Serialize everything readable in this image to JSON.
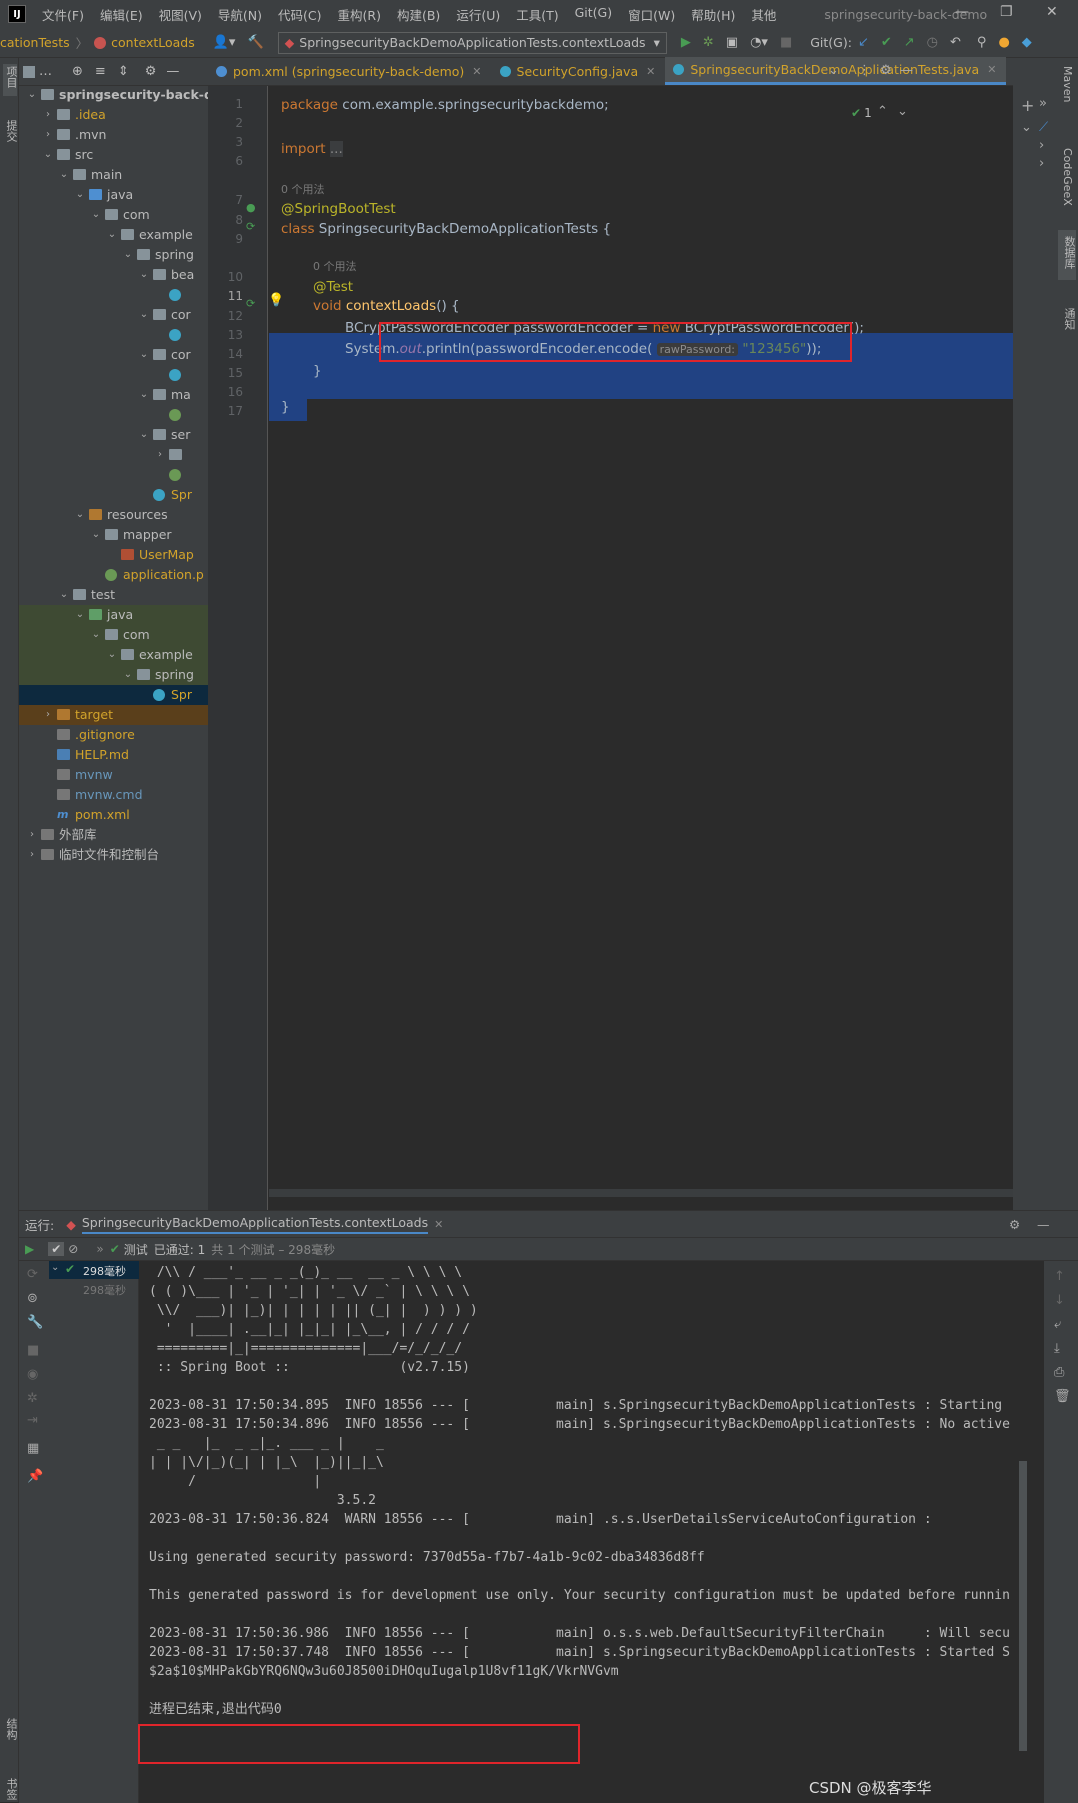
{
  "app": {
    "window_title": "springsecurity-back-demo",
    "menu": [
      "文件(F)",
      "编辑(E)",
      "视图(V)",
      "导航(N)",
      "代码(C)",
      "重构(R)",
      "构建(B)",
      "运行(U)",
      "工具(T)",
      "Git(G)",
      "窗口(W)",
      "帮助(H)",
      "其他"
    ],
    "window_controls": [
      "minimize-icon",
      "restore-icon",
      "close-icon"
    ]
  },
  "toolbar": {
    "breadcrumb": [
      "cationTests",
      "contextLoads"
    ],
    "run_config": "SpringsecurityBackDemoApplicationTests.contextLoads",
    "git_label": "Git(G):"
  },
  "left_strip": {
    "project_label": "项目",
    "commit_label": "提交",
    "bookmarks_label": "书签",
    "structure_label": "结构"
  },
  "project": {
    "header_label": "…",
    "tree": [
      {
        "label": "springsecurity-back-demo",
        "indent": 0,
        "expanded": true,
        "icon": "folder",
        "bold": true
      },
      {
        "label": ".idea",
        "indent": 1,
        "expanded": false,
        "icon": "folder",
        "color": "#d2a32b"
      },
      {
        "label": ".mvn",
        "indent": 1,
        "expanded": false,
        "icon": "folder"
      },
      {
        "label": "src",
        "indent": 1,
        "expanded": true,
        "icon": "folder"
      },
      {
        "label": "main",
        "indent": 2,
        "expanded": true,
        "icon": "folder"
      },
      {
        "label": "java",
        "indent": 3,
        "expanded": true,
        "icon": "folder-src"
      },
      {
        "label": "com",
        "indent": 4,
        "expanded": true,
        "icon": "folder"
      },
      {
        "label": "example",
        "indent": 5,
        "expanded": true,
        "icon": "folder"
      },
      {
        "label": "spring",
        "indent": 6,
        "expanded": true,
        "icon": "folder"
      },
      {
        "label": "bea",
        "indent": 7,
        "expanded": true,
        "icon": "folder"
      },
      {
        "label": "",
        "indent": 8,
        "icon": "class"
      },
      {
        "label": "cor",
        "indent": 7,
        "expanded": true,
        "icon": "folder"
      },
      {
        "label": "",
        "indent": 8,
        "icon": "class"
      },
      {
        "label": "cor",
        "indent": 7,
        "expanded": true,
        "icon": "folder"
      },
      {
        "label": "",
        "indent": 8,
        "icon": "class"
      },
      {
        "label": "ma",
        "indent": 7,
        "expanded": true,
        "icon": "folder"
      },
      {
        "label": "",
        "indent": 8,
        "icon": "interface"
      },
      {
        "label": "ser",
        "indent": 7,
        "expanded": true,
        "icon": "folder"
      },
      {
        "label": "",
        "indent": 8,
        "expanded": false,
        "icon": "folder"
      },
      {
        "label": "",
        "indent": 8,
        "icon": "interface"
      },
      {
        "label": "Spr",
        "indent": 7,
        "icon": "class",
        "color": "#d2a32b"
      },
      {
        "label": "resources",
        "indent": 3,
        "expanded": true,
        "icon": "folder-res"
      },
      {
        "label": "mapper",
        "indent": 4,
        "expanded": true,
        "icon": "folder"
      },
      {
        "label": "UserMap",
        "indent": 5,
        "icon": "xml",
        "color": "#d2a32b"
      },
      {
        "label": "application.p",
        "indent": 4,
        "icon": "spring",
        "color": "#d2a32b"
      },
      {
        "label": "test",
        "indent": 2,
        "expanded": true,
        "icon": "folder"
      },
      {
        "label": "java",
        "indent": 3,
        "expanded": true,
        "icon": "folder-test",
        "hl": "test"
      },
      {
        "label": "com",
        "indent": 4,
        "expanded": true,
        "icon": "folder",
        "hl": "test"
      },
      {
        "label": "example",
        "indent": 5,
        "expanded": true,
        "icon": "folder",
        "hl": "test"
      },
      {
        "label": "spring",
        "indent": 6,
        "expanded": true,
        "icon": "folder",
        "hl": "test"
      },
      {
        "label": "Spr",
        "indent": 7,
        "icon": "class",
        "hl": "sel",
        "color": "#d2a32b"
      },
      {
        "label": "target",
        "indent": 1,
        "expanded": false,
        "icon": "folder-target",
        "hl": "target",
        "color": "#d2a32b"
      },
      {
        "label": ".gitignore",
        "indent": 1,
        "icon": "file",
        "color": "#d2a32b"
      },
      {
        "label": "HELP.md",
        "indent": 1,
        "icon": "md",
        "color": "#d2a32b"
      },
      {
        "label": "mvnw",
        "indent": 1,
        "icon": "sh",
        "color": "#6897bb"
      },
      {
        "label": "mvnw.cmd",
        "indent": 1,
        "icon": "sh",
        "color": "#6897bb"
      },
      {
        "label": "pom.xml",
        "indent": 1,
        "icon": "maven",
        "color": "#d2a32b"
      },
      {
        "label": "外部库",
        "indent": 0,
        "expanded": false,
        "icon": "lib"
      },
      {
        "label": "临时文件和控制台",
        "indent": 0,
        "expanded": false,
        "icon": "scratch"
      }
    ]
  },
  "editor": {
    "tabs": [
      {
        "label": "pom.xml (springsecurity-back-demo)",
        "color": "#d2a32b",
        "active": false
      },
      {
        "label": "SecurityConfig.java",
        "color": "#d2a32b",
        "active": false
      },
      {
        "label": "SpringsecurityBackDemoApplicationTests.java",
        "color": "#d2a32b",
        "active": true
      }
    ],
    "inspection": "1",
    "code": {
      "package_kw": "package",
      "package_name": " com.example.springsecuritybackdemo;",
      "import_kw": "import",
      "import_fold": "...",
      "usage_hint_1": "0 个用法",
      "annotation_1": "@SpringBootTest",
      "class_kw": "class",
      "class_name": " SpringsecurityBackDemoApplicationTests {",
      "usage_hint_2": "0 个用法",
      "annotation_2": "@Test",
      "void_kw": "void",
      "method_name": "contextLoads",
      "method_rest": "() {",
      "encoder_type": "BCryptPasswordEncoder passwordEncoder = ",
      "new_kw": "new",
      "encoder_ctor": " BCryptPasswordEncoder();",
      "sysout_a": "System.",
      "sysout_out": "out",
      "sysout_b": ".println(passwordEncoder.encode(",
      "param_hint": "rawPassword:",
      "password_literal": "\"123456\"",
      "sysout_c": "));",
      "close_method": "}",
      "close_class": "}"
    },
    "line_numbers": [
      "1",
      "2",
      "3",
      "6",
      "7",
      "8",
      "9",
      "10",
      "11",
      "12",
      "13",
      "14",
      "15",
      "16",
      "17"
    ]
  },
  "right_strip": {
    "maven_label": "Maven",
    "codegeex_label": "CodeGeeX",
    "database_label": "数据库",
    "notifications_label": "通知"
  },
  "run": {
    "label": "运行:",
    "tab_label": "SpringsecurityBackDemoApplicationTests.contextLoads",
    "status_prefix": "测试",
    "status_passed": "已通过: 1",
    "status_detail": "共 1 个测试 – 298毫秒",
    "tree_items": [
      {
        "label": "298毫秒",
        "passed": true
      },
      {
        "label": "298毫秒",
        "passed": null
      }
    ],
    "console_lines": [
      " /\\\\ / ___'_ __ _ _(_)_ __  __ _ \\ \\ \\ \\",
      "( ( )\\___ | '_ | '_| | '_ \\/ _` | \\ \\ \\ \\",
      " \\\\/  ___)| |_)| | | | | || (_| |  ) ) ) )",
      "  '  |____| .__|_| |_|_| |_\\__, | / / / /",
      " =========|_|==============|___/=/_/_/_/",
      " :: Spring Boot ::              (v2.7.15)",
      "",
      "2023-08-31 17:50:34.895  INFO 18556 --- [           main] s.SpringsecurityBackDemoApplicationTests : Starting",
      "2023-08-31 17:50:34.896  INFO 18556 --- [           main] s.SpringsecurityBackDemoApplicationTests : No active",
      " _ _   |_  _ _|_. ___ _ |    _",
      "| | |\\/|_)(_| | |_\\  |_)||_|_\\",
      "     /               |",
      "                        3.5.2",
      "2023-08-31 17:50:36.824  WARN 18556 --- [           main] .s.s.UserDetailsServiceAutoConfiguration :",
      "",
      "Using generated security password: 7370d55a-f7b7-4a1b-9c02-dba34836d8ff",
      "",
      "This generated password is for development use only. Your security configuration must be updated before runnin",
      "",
      "2023-08-31 17:50:36.986  INFO 18556 --- [           main] o.s.s.web.DefaultSecurityFilterChain     : Will secu",
      "2023-08-31 17:50:37.748  INFO 18556 --- [           main] s.SpringsecurityBackDemoApplicationTests : Started S",
      "$2a$10$MHPakGbYRQ6NQw3u60J8500iDHOquIugalp1U8vf11gK/VkrNVGvm",
      "",
      "进程已结束,退出代码0"
    ]
  },
  "watermark": "CSDN @极客李华"
}
